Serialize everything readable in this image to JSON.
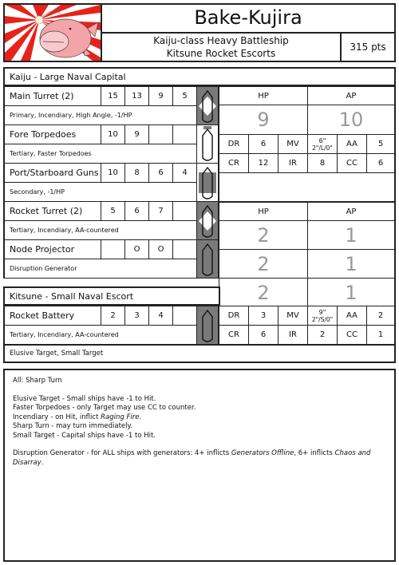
{
  "header": {
    "title": "Bake-Kujira",
    "subtitle_line1": "Kaiju-class Heavy Battleship",
    "subtitle_line2": "Kitsune Rocket Escorts",
    "points": "315 pts",
    "logo_icon": "pink-fish-kaiju-rising-sun-icon",
    "logo_colors": {
      "ray": "#e8221b",
      "fish": "#f4a3a9",
      "fish_lip": "#f9c9cd"
    }
  },
  "kaiju": {
    "section_label": "Kaiju - Large Naval Capital",
    "weapons": [
      {
        "name": "Main Turret (2)",
        "values": [
          "15",
          "13",
          "9",
          "5"
        ],
        "traits": "Primary, Incendiary, High Angle, -1/HP",
        "arc": "turret-gray"
      },
      {
        "name": "Fore Torpedoes",
        "values": [
          "10",
          "9",
          "",
          ""
        ],
        "traits": "Tertiary, Faster Torpedoes",
        "arc": "fore"
      },
      {
        "name": "Port/Starboard Guns",
        "values": [
          "10",
          "8",
          "6",
          "4"
        ],
        "traits": "Secondary, -1/HP",
        "arc": "sides"
      },
      {
        "name": "Rocket Turret (2)",
        "values": [
          "5",
          "6",
          "7",
          ""
        ],
        "traits": "Tertiary, Incendiary, AA-countered",
        "arc": "turret-gray"
      },
      {
        "name": "Node Projector",
        "values": [
          "",
          "O",
          "O",
          ""
        ],
        "traits": "Disruption Generator",
        "arc": "all-gray"
      }
    ],
    "stats": {
      "hp_label": "HP",
      "ap_label": "AP",
      "hp": "9",
      "ap": "10",
      "row1": [
        "DR",
        "6",
        "MV",
        "6\"",
        "2\"/L/0\"",
        "AA",
        "5"
      ],
      "row2": [
        "CR",
        "12",
        "IR",
        "8",
        "CC",
        "6"
      ]
    }
  },
  "kitsune": {
    "section_label": "Kitsune - Small Naval Escort",
    "weapons": [
      {
        "name": "Rocket Battery",
        "values": [
          "2",
          "3",
          "4",
          ""
        ],
        "traits": "Tertiary, Incendiary, AA-countered",
        "arc": "all-gray"
      }
    ],
    "special": "Elusive Target, Small Target",
    "stats": {
      "hp_label": "HP",
      "ap_label": "AP",
      "ships": [
        {
          "hp": "2",
          "ap": "1"
        },
        {
          "hp": "2",
          "ap": "1"
        },
        {
          "hp": "2",
          "ap": "1"
        }
      ],
      "row1": [
        "DR",
        "3",
        "MV",
        "9\"",
        "2\"/S/0\"",
        "AA",
        "2"
      ],
      "row2": [
        "CR",
        "6",
        "IR",
        "2",
        "CC",
        "1"
      ]
    }
  },
  "rules": {
    "all": "All: Sharp Turn",
    "lines": [
      {
        "pre": "Elusive Target - Small ships have -1 to Hit.",
        "em": "",
        "post": ""
      },
      {
        "pre": "Faster Torpedoes - only Target may use CC to counter.",
        "em": "",
        "post": ""
      },
      {
        "pre": "Incendiary - on Hit, inflict ",
        "em": "Raging Fire",
        "post": "."
      },
      {
        "pre": "Sharp Turn - may turn immediately.",
        "em": "",
        "post": ""
      },
      {
        "pre": "Small Target - Capital ships have -1 to Hit.",
        "em": "",
        "post": ""
      }
    ],
    "disruption": {
      "pre": "Disruption Generator - for ALL ships with generators: 4+ inflicts ",
      "em1": "Generators Offline",
      "mid": ", 6+ inflicts ",
      "em2": "Chaos and Disarray",
      "post": "."
    }
  }
}
